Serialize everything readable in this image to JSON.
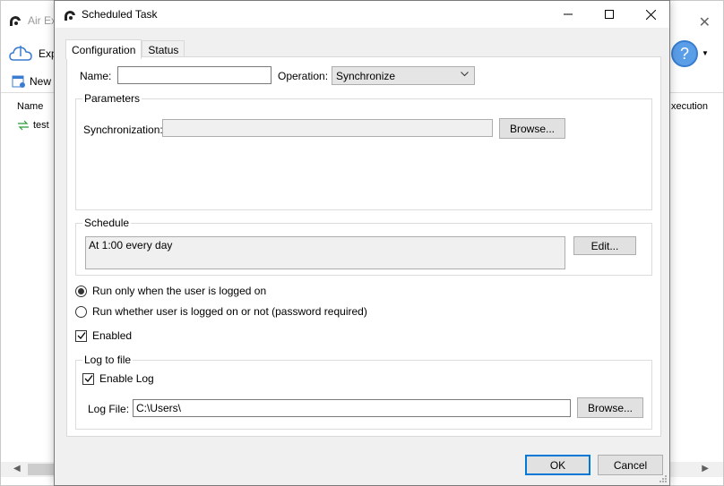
{
  "background_app": {
    "title": "Air Ex",
    "toolbar_label": "Exp",
    "new_label": "New T",
    "columns": {
      "name": "Name",
      "execution": "xecution"
    },
    "rows": [
      {
        "label": "test"
      }
    ],
    "help_glyph": "?"
  },
  "dialog": {
    "title": "Scheduled Task",
    "icons": {
      "logo": "app-logo-icon",
      "minimize": "minimize-icon",
      "maximize": "maximize-icon",
      "close": "close-icon"
    }
  },
  "tabs": [
    {
      "label": "Configuration",
      "active": true
    },
    {
      "label": "Status",
      "active": false
    }
  ],
  "form": {
    "name_label": "Name:",
    "name_value": "",
    "operation_label": "Operation:",
    "operation_value": "Synchronize"
  },
  "parameters": {
    "group_title": "Parameters",
    "sync_label": "Synchronization:",
    "sync_value": "",
    "browse_label": "Browse..."
  },
  "schedule": {
    "group_title": "Schedule",
    "value": "At 1:00 every day",
    "edit_label": "Edit..."
  },
  "run_options": [
    {
      "label": "Run only when the user is logged on",
      "selected": true
    },
    {
      "label": "Run whether user is logged on or not (password required)",
      "selected": false
    }
  ],
  "enabled": {
    "label": "Enabled",
    "checked": true
  },
  "log": {
    "group_title": "Log to file",
    "enable_label": "Enable Log",
    "enable_checked": true,
    "file_label": "Log File:",
    "file_value": "C:\\Users\\",
    "browse_label": "Browse..."
  },
  "footer": {
    "ok_label": "OK",
    "cancel_label": "Cancel"
  },
  "colors": {
    "accent": "#0078d7",
    "dialog_bg": "#f0f0f0",
    "panel_bg": "#ffffff"
  }
}
